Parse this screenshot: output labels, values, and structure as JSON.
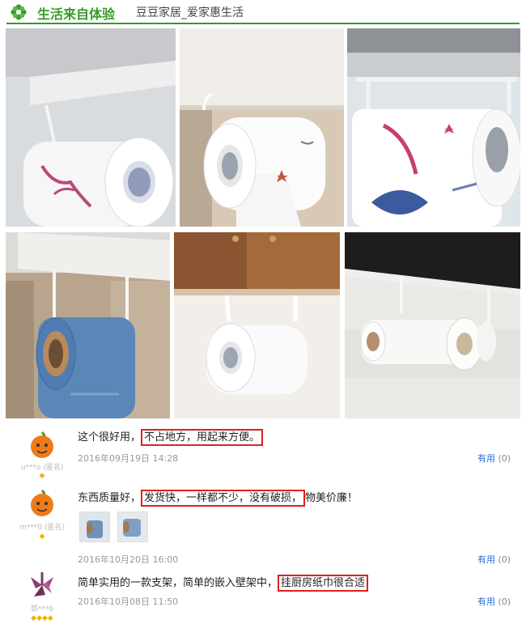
{
  "header": {
    "title": "生活来自体验",
    "subtitle": "豆豆家居_爱家惠生活"
  },
  "photos": [
    {
      "name": "photo-1",
      "desc": "roll-pink"
    },
    {
      "name": "photo-2",
      "desc": "roll-cabinet"
    },
    {
      "name": "photo-3",
      "desc": "roll-fish"
    },
    {
      "name": "photo-4",
      "desc": "roll-blue"
    },
    {
      "name": "photo-5",
      "desc": "roll-wood"
    },
    {
      "name": "photo-6",
      "desc": "roll-dark"
    }
  ],
  "reviews": [
    {
      "user": "u***o (匿名)",
      "text_pre": "这个很好用，",
      "text_hl": "不占地方，用起来方便。",
      "text_post": "",
      "date": "2016年09月19日 14:28",
      "useful_label": "有用",
      "useful_count": "(0)",
      "stars": "◆"
    },
    {
      "user": "m***0 (匿名)",
      "text_pre": "东西质量好，",
      "text_hl": "发货快，一样都不少，没有破损，",
      "text_post": "物美价廉！",
      "date": "2016年10月20日 16:00",
      "useful_label": "有用",
      "useful_count": "(0)",
      "stars": "◆"
    },
    {
      "user": "郭***6",
      "text_pre": "简单实用的一款支架，简单的嵌入壁架中，",
      "text_hl": "挂厨房纸巾很合适",
      "text_post": "",
      "date": "2016年10月08日 11:50",
      "useful_label": "有用",
      "useful_count": "(0)",
      "stars": "◆◆◆◆"
    }
  ],
  "colors": {
    "brand_green": "#3a9a2b",
    "highlight_red": "#e02020",
    "link_blue": "#2a6fd6"
  }
}
